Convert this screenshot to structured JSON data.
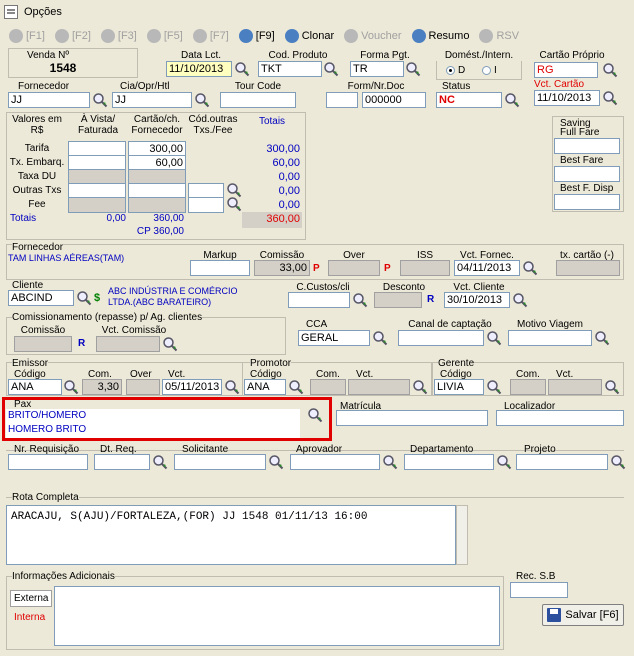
{
  "window": {
    "title": "Opções"
  },
  "toolbar": [
    {
      "key": "back",
      "label": "[F1]",
      "on": false
    },
    {
      "key": "next",
      "label": "[F2]",
      "on": false
    },
    {
      "key": "add",
      "label": "[F3]",
      "on": false
    },
    {
      "key": "edit",
      "label": "[F5]",
      "on": false
    },
    {
      "key": "search",
      "label": "[F7]",
      "on": false
    },
    {
      "key": "print",
      "label": "[F9]",
      "on": true
    },
    {
      "key": "clone",
      "label": "Clonar",
      "on": true
    },
    {
      "key": "voucher",
      "label": "Voucher",
      "on": false
    },
    {
      "key": "resumo",
      "label": "Resumo",
      "on": true
    },
    {
      "key": "rsv",
      "label": "RSV",
      "on": false
    }
  ],
  "venda": {
    "label": "Venda Nº",
    "value": "1548"
  },
  "data_lct": {
    "label": "Data Lct.",
    "value": "11/10/2013"
  },
  "cod_produto": {
    "label": "Cod. Produto",
    "value": "TKT"
  },
  "forma_pgt": {
    "label": "Forma Pgt.",
    "value": "TR"
  },
  "domest": {
    "label": "Domést./Intern.",
    "opt_d": "D",
    "opt_i": "I"
  },
  "cartao_proprio": {
    "label": "Cartão Próprio",
    "value": "RG"
  },
  "vct_cartao": {
    "label": "Vct. Cartão",
    "value": "11/10/2013"
  },
  "fornecedor_top": {
    "label": "Fornecedor",
    "value": "JJ"
  },
  "cia": {
    "label": "Cia/Opr/Htl",
    "value": "JJ"
  },
  "tour_code": {
    "label": "Tour Code",
    "value": ""
  },
  "form_nr": {
    "label": "Form/Nr.Doc",
    "value": "000000"
  },
  "status": {
    "label": "Status",
    "value": "NC"
  },
  "valores": {
    "h_valores": "Valores em R$",
    "h_avista": "À Vista/ Faturada",
    "h_cartao": "Cartão/ch. Fornecedor",
    "h_codout": "Cód.outras Txs./Fee",
    "h_totais": "Totais",
    "rows": [
      {
        "label": "Tarifa",
        "avista": "",
        "cartao": "300,00",
        "total": "300,00"
      },
      {
        "label": "Tx. Embarq.",
        "avista": "",
        "cartao": "60,00",
        "total": "60,00"
      },
      {
        "label": "Taxa DU",
        "avista": "",
        "cartao": "",
        "total": "0,00"
      },
      {
        "label": "Outras Txs",
        "avista": "",
        "cartao": "",
        "total": "0,00"
      },
      {
        "label": "Fee",
        "avista": "",
        "cartao": "",
        "total": "0,00"
      }
    ],
    "tot_label": "Totais",
    "tot_avista": "0,00",
    "tot_cartao": "360,00",
    "cp": "CP 360,00",
    "tot_total": "360,00"
  },
  "saving": {
    "label": "Saving",
    "full_fare": "Full Fare",
    "best_fare": "Best Fare",
    "best_disp": "Best F. Disp"
  },
  "fornecedor": {
    "label": "Fornecedor",
    "value": "TAM LINHAS AÉREAS(TAM)",
    "markup": "Markup",
    "comissao": "Comissão",
    "comissao_val": "33,00",
    "p": "P",
    "over": "Over",
    "iss": "ISS",
    "vct_fornec": "Vct. Fornec.",
    "vct_fornec_val": "04/11/2013",
    "tx_cartao": "tx. cartão (-)"
  },
  "cliente": {
    "label": "Cliente",
    "value": "ABCIND",
    "name1": "ABC INDÚSTRIA E COMÉRCIO",
    "name2": "LTDA.(ABC BARATEIRO)",
    "ccustos": "C.Custos/cli",
    "desconto": "Desconto",
    "r": "R",
    "vct_cliente": "Vct. Cliente",
    "vct_cliente_val": "30/10/2013"
  },
  "comissionamento": {
    "label": "Comissionamento (repasse) p/ Ag. clientes",
    "comissao": "Comissão",
    "vct": "Vct. Comissão"
  },
  "cca": {
    "label": "CCA",
    "value": "GERAL"
  },
  "canal": {
    "label": "Canal de captação"
  },
  "motivo": {
    "label": "Motivo Viagem"
  },
  "emissor": {
    "label": "Emissor",
    "codigo": "Código",
    "com": "Com.",
    "over": "Over",
    "vct": "Vct.",
    "codigo_val": "ANA",
    "com_val": "3,30",
    "vct_val": "05/11/2013"
  },
  "promotor": {
    "label": "Promotor",
    "codigo": "Código",
    "com": "Com.",
    "vct": "Vct.",
    "codigo_val": "ANA"
  },
  "gerente": {
    "label": "Gerente",
    "codigo": "Código",
    "com": "Com.",
    "vct": "Vct.",
    "codigo_val": "LIVIA"
  },
  "pax": {
    "label": "Pax",
    "line1": "BRITO/HOMERO",
    "line2": "HOMERO BRITO"
  },
  "matricula": {
    "label": "Matrícula"
  },
  "localizador": {
    "label": "Localizador"
  },
  "req": {
    "nr": "Nr. Requisição",
    "dt": "Dt. Req.",
    "solicitante": "Solicitante",
    "aprovador": "Aprovador",
    "departamento": "Departamento",
    "projeto": "Projeto"
  },
  "rota": {
    "label": "Rota Completa",
    "value": "ARACAJU, S(AJU)/FORTALEZA,(FOR) JJ 1548 01/11/13 16:00"
  },
  "info": {
    "label": "Informações Adicionais",
    "externa": "Externa",
    "interna": "Interna"
  },
  "rec_sb": {
    "label": "Rec. S.B"
  },
  "salvar": {
    "label": "Salvar [F6]"
  }
}
